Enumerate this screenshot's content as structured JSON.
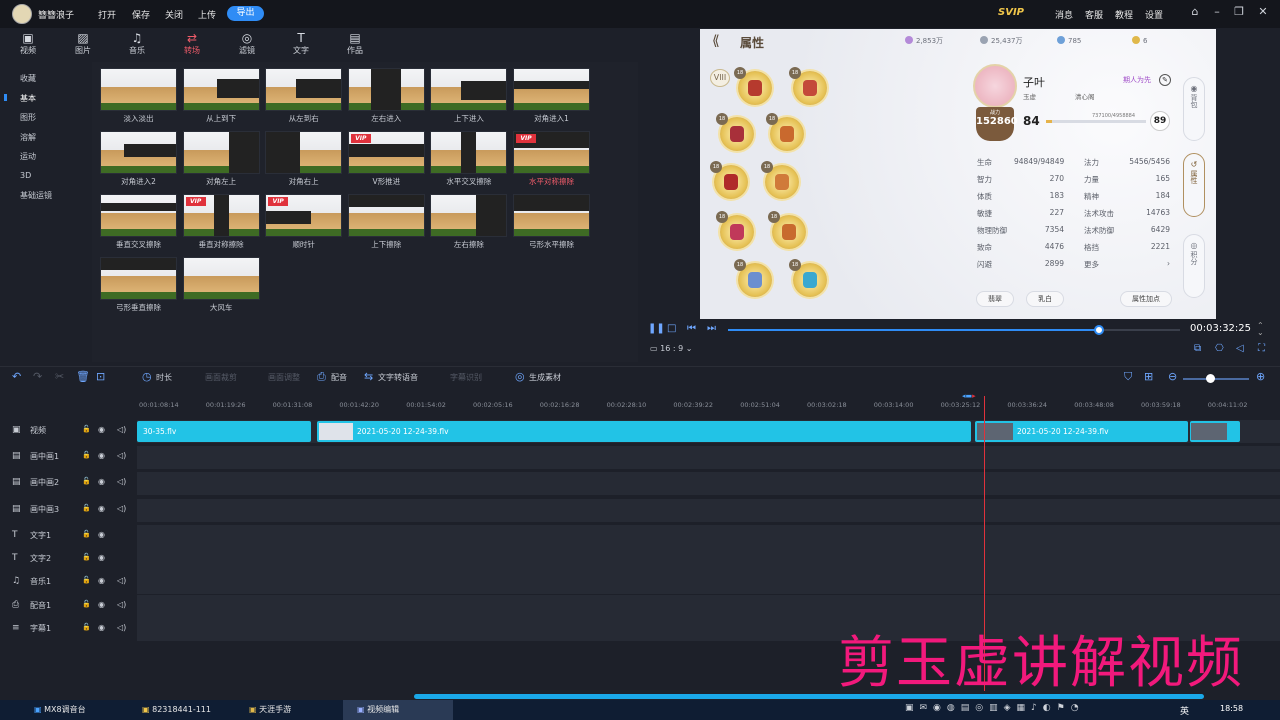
{
  "app": {
    "name": "簪簪浪子"
  },
  "menu": {
    "open": "打开",
    "save": "保存",
    "close": "关闭",
    "upload": "上传",
    "export": "导出"
  },
  "topright": {
    "svip": "SVIP",
    "messages": "消息",
    "service": "客服",
    "tutorial": "教程",
    "settings": "设置"
  },
  "tabs": [
    {
      "label": "视频",
      "icon": "▣"
    },
    {
      "label": "图片",
      "icon": "▨"
    },
    {
      "label": "音乐",
      "icon": "♫"
    },
    {
      "label": "转场",
      "icon": "⇄"
    },
    {
      "label": "滤镜",
      "icon": "◎"
    },
    {
      "label": "文字",
      "icon": "T"
    },
    {
      "label": "作品",
      "icon": "▤"
    }
  ],
  "categories": [
    "收藏",
    "基本",
    "图形",
    "溶解",
    "运动",
    "3D",
    "基础运镜"
  ],
  "transitions": [
    {
      "label": "淡入淡出",
      "vip": false
    },
    {
      "label": "从上到下",
      "vip": false
    },
    {
      "label": "从左到右",
      "vip": false
    },
    {
      "label": "左右进入",
      "vip": false
    },
    {
      "label": "上下进入",
      "vip": false
    },
    {
      "label": "对角进入1",
      "vip": false
    },
    {
      "label": "对角进入2",
      "vip": false
    },
    {
      "label": "对角左上",
      "vip": false
    },
    {
      "label": "对角右上",
      "vip": false
    },
    {
      "label": "V形推进",
      "vip": true
    },
    {
      "label": "水平交叉擦除",
      "vip": false
    },
    {
      "label": "水平对称擦除",
      "vip": true
    },
    {
      "label": "垂直交叉擦除",
      "vip": false
    },
    {
      "label": "垂直对称擦除",
      "vip": true
    },
    {
      "label": "顺时针",
      "vip": true
    },
    {
      "label": "上下擦除",
      "vip": false
    },
    {
      "label": "左右擦除",
      "vip": false
    },
    {
      "label": "弓形水平擦除",
      "vip": false
    },
    {
      "label": "弓形垂直擦除",
      "vip": false
    },
    {
      "label": "大风车",
      "vip": false
    }
  ],
  "preview": {
    "title": "属性",
    "currencies": [
      "2,853万",
      "25,437万",
      "785",
      "6"
    ],
    "char_name": "子叶",
    "friend_label": "期人为先",
    "sub1": "玉虚",
    "sub2": "清心阁",
    "power_label": "战力",
    "power": "152860",
    "level": "84",
    "exp": "737100/4958884",
    "badge": "89",
    "roman": "VIII",
    "slot_level": "18",
    "stats_left": [
      {
        "k": "生命",
        "v": "94849/94849"
      },
      {
        "k": "智力",
        "v": "270"
      },
      {
        "k": "体质",
        "v": "183"
      },
      {
        "k": "敏捷",
        "v": "227"
      },
      {
        "k": "物理防御",
        "v": "7354"
      },
      {
        "k": "致命",
        "v": "4476"
      },
      {
        "k": "闪避",
        "v": "2899"
      }
    ],
    "stats_right": [
      {
        "k": "法力",
        "v": "5456/5456"
      },
      {
        "k": "力量",
        "v": "165"
      },
      {
        "k": "精神",
        "v": "184"
      },
      {
        "k": "法术攻击",
        "v": "14763"
      },
      {
        "k": "法术防御",
        "v": "6429"
      },
      {
        "k": "格挡",
        "v": "2221"
      },
      {
        "k": "更多",
        "v": "›"
      }
    ],
    "side_tabs": [
      "背包",
      "属性",
      "积分"
    ],
    "bottom": {
      "a": "翡翠",
      "b": "乳白",
      "c": "属性加点"
    }
  },
  "player": {
    "ratio": "16 : 9",
    "time": "00:03:32:25",
    "progress": 0.82
  },
  "timeline_tools": {
    "duration": "时长",
    "dim1": "画面裁剪",
    "dim2": "画面调整",
    "dub": "配音",
    "tts": "文字转语音",
    "dim3": "字幕识别",
    "gen": "生成素材"
  },
  "ruler": [
    "00:01:08:14",
    "00:01:19:26",
    "00:01:31:08",
    "00:01:42:20",
    "00:01:54:02",
    "00:02:05:16",
    "00:02:16:28",
    "00:02:28:10",
    "00:02:39:22",
    "00:02:51:04",
    "00:03:02:18",
    "00:03:14:00",
    "00:03:25:12",
    "00:03:36:24",
    "00:03:48:08",
    "00:03:59:18",
    "00:04:11:02"
  ],
  "tracks": [
    {
      "label": "视频",
      "icon": "▣"
    },
    {
      "label": "画中画1",
      "icon": "▤"
    },
    {
      "label": "画中画2",
      "icon": "▤"
    },
    {
      "label": "画中画3",
      "icon": "▤"
    },
    {
      "label": "文字1",
      "icon": "T"
    },
    {
      "label": "文字2",
      "icon": "T"
    },
    {
      "label": "音乐1",
      "icon": "♫"
    },
    {
      "label": "配音1",
      "icon": "⎙"
    },
    {
      "label": "字幕1",
      "icon": "≡"
    }
  ],
  "clips": [
    "30-35.flv",
    "2021-05-20 12-24-39.flv",
    "2021-05-20 12-24-39.flv"
  ],
  "watermark": "剪玉虚讲解视频",
  "taskbar": {
    "items": [
      "MX8调音台",
      "82318441-111",
      "天涯手游",
      "视频编辑"
    ],
    "lang": "英",
    "clock": "18:58"
  },
  "colors": {
    "accent": "#2f8cf5",
    "clip": "#22c3e6",
    "active_tab": "#f05c6a",
    "watermark": "#f2197c"
  }
}
